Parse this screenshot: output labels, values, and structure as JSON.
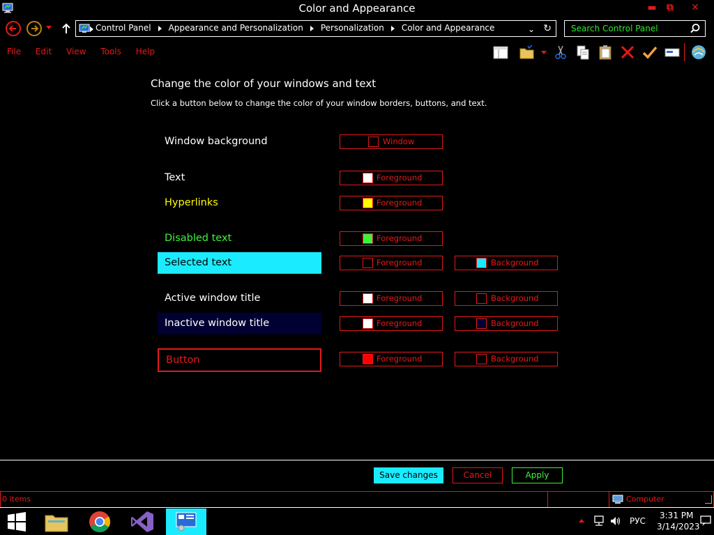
{
  "window": {
    "title": "Color and Appearance",
    "minimize_glyph": "▬",
    "maximize_glyph": "⧉",
    "close_glyph": "✕"
  },
  "address": {
    "crumbs": [
      "Control Panel",
      "Appearance and Personalization",
      "Personalization",
      "Color and Appearance"
    ],
    "chevron": "⌄",
    "refresh_glyph": "↻"
  },
  "search": {
    "placeholder": "Search Control Panel"
  },
  "menu": [
    "File",
    "Edit",
    "View",
    "Tools",
    "Help"
  ],
  "toolbar_icons": [
    "layout-icon",
    "folder-icon",
    "cut-icon",
    "copy-icon",
    "paste-icon",
    "delete-icon",
    "checkmark-icon",
    "properties-icon",
    "shell-icon"
  ],
  "content": {
    "heading": "Change the color of your windows and text",
    "subheading": "Click a button below to change the color of your window borders, buttons, and text.",
    "rows": [
      {
        "label": "Window background",
        "label_color": "#ffffff",
        "label_bg": "transparent",
        "fg_label": "Window",
        "fg_swatch": "#000000",
        "bg_label": null,
        "bg_swatch": null
      },
      {
        "label": "Text",
        "label_color": "#ffffff",
        "label_bg": "transparent",
        "fg_label": "Foreground",
        "fg_swatch": "#ffffff",
        "bg_label": null,
        "bg_swatch": null
      },
      {
        "label": "Hyperlinks",
        "label_color": "#ffff00",
        "label_bg": "transparent",
        "fg_label": "Foreground",
        "fg_swatch": "#ffff00",
        "bg_label": null,
        "bg_swatch": null
      },
      {
        "label": "Disabled text",
        "label_color": "#3ff23f",
        "label_bg": "transparent",
        "fg_label": "Foreground",
        "fg_swatch": "#3ff23f",
        "bg_label": null,
        "bg_swatch": null
      },
      {
        "label": "Selected text",
        "label_color": "#000000",
        "label_bg": "#1aebff",
        "fg_label": "Foreground",
        "fg_swatch": "#000000",
        "bg_label": "Background",
        "bg_swatch": "#1aebff"
      },
      {
        "label": "Active window title",
        "label_color": "#ffffff",
        "label_bg": "transparent",
        "fg_label": "Foreground",
        "fg_swatch": "#ffffff",
        "bg_label": "Background",
        "bg_swatch": "#000000"
      },
      {
        "label": "Inactive window title",
        "label_color": "#ffffff",
        "label_bg": "#000033",
        "fg_label": "Foreground",
        "fg_swatch": "#ffffff",
        "bg_label": "Background",
        "bg_swatch": "#000033"
      },
      {
        "label": "Button",
        "label_color": "#e51919",
        "label_bg": "transparent",
        "fg_label": "Foreground",
        "fg_swatch": "#ff0000",
        "bg_label": "Background",
        "bg_swatch": "#000000"
      }
    ]
  },
  "buttons": {
    "save": "Save changes",
    "cancel": "Cancel",
    "apply": "Apply"
  },
  "status": {
    "items": "0 items",
    "location": "Computer"
  },
  "taskbar": {
    "apps": [
      "start-button",
      "file-explorer",
      "chrome",
      "visual-studio",
      "control-panel"
    ],
    "lang": "РУС",
    "time": "3:31 PM",
    "date": "3/14/2023"
  },
  "colors": {
    "accent_red": "#e51919",
    "cyan": "#1aebff",
    "green": "#3ff23f",
    "yellow": "#ffff00"
  }
}
